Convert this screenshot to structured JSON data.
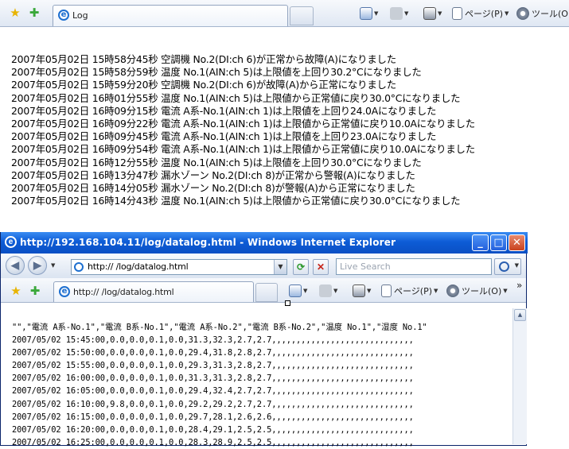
{
  "back_window": {
    "tab_title": "Log",
    "commands": [
      {
        "label": "ページ(P)",
        "icon": "page-icon"
      },
      {
        "label": "ツール(O)",
        "icon": "gear-icon"
      }
    ],
    "log_lines": [
      "2007年05月02日 15時58分45秒 空調機 No.2(DI:ch 6)が正常から故障(A)になりました",
      "2007年05月02日 15時58分59秒 温度 No.1(AIN:ch 5)は上限値を上回り30.2°Cになりました",
      "2007年05月02日 15時59分20秒 空調機 No.2(DI:ch 6)が故障(A)から正常になりました",
      "2007年05月02日 16時01分55秒 温度 No.1(AIN:ch 5)は上限値から正常値に戻り30.0°Cになりました",
      "2007年05月02日 16時09分15秒 電流 A系-No.1(AIN:ch 1)は上限値を上回り24.0Aになりました",
      "2007年05月02日 16時09分22秒 電流 A系-No.1(AIN:ch 1)は上限値から正常値に戻り10.0Aになりました",
      "2007年05月02日 16時09分45秒 電流 A系-No.1(AIN:ch 1)は上限値を上回り23.0Aになりました",
      "2007年05月02日 16時09分54秒 電流 A系-No.1(AIN:ch 1)は上限値から正常値に戻り10.0Aになりました",
      "2007年05月02日 16時12分55秒 温度 No.1(AIN:ch 5)は上限値を上回り30.0°Cになりました",
      "2007年05月02日 16時13分47秒 漏水ゾーン No.2(DI:ch 8)が正常から警報(A)になりました",
      "2007年05月02日 16時14分05秒 漏水ゾーン No.2(DI:ch 8)が警報(A)から正常になりました",
      "2007年05月02日 16時14分43秒 温度 No.1(AIN:ch 5)は上限値から正常値に戻り30.0°Cになりました"
    ]
  },
  "front_window": {
    "title": "http://192.168.104.11/log/datalog.html - Windows Internet Explorer",
    "address": "http://                   /log/datalog.html",
    "search_placeholder": "Live Search",
    "tab_title": "http://               /log/datalog.html",
    "commands": [
      {
        "label": "ページ(P)",
        "icon": "page-icon"
      },
      {
        "label": "ツール(O)",
        "icon": "gear-icon"
      }
    ],
    "overflow": "»",
    "csv_lines": [
      "\"\",\"電流 A系-No.1\",\"電流 B系-No.1\",\"電流 A系-No.2\",\"電流 B系-No.2\",\"温度 No.1\",\"湿度 No.1\"",
      "2007/05/02 15:45:00,0.0,0.0,0.1,0.0,31.3,32.3,2.7,2.7,,,,,,,,,,,,,,,,,,,,,,,,,,,,,",
      "2007/05/02 15:50:00,0.0,0.0,0.1,0.0,29.4,31.8,2.8,2.7,,,,,,,,,,,,,,,,,,,,,,,,,,,,,",
      "2007/05/02 15:55:00,0.0,0.0,0.1,0.0,29.3,31.3,2.8,2.7,,,,,,,,,,,,,,,,,,,,,,,,,,,,,",
      "2007/05/02 16:00:00,0.0,0.0,0.1,0.0,31.3,31.3,2.8,2.7,,,,,,,,,,,,,,,,,,,,,,,,,,,,,",
      "2007/05/02 16:05:00,0.0,0.0,0.1,0.0,29.4,32.4,2.7,2.7,,,,,,,,,,,,,,,,,,,,,,,,,,,,,",
      "2007/05/02 16:10:00,9.8,0.0,0.1,0.0,29.2,29.2,2.7,2.7,,,,,,,,,,,,,,,,,,,,,,,,,,,,,",
      "2007/05/02 16:15:00,0.0,0.0,0.1,0.0,29.7,28.1,2.6,2.6,,,,,,,,,,,,,,,,,,,,,,,,,,,,,",
      "2007/05/02 16:20:00,0.0,0.0,0.1,0.0,28.4,29.1,2.5,2.5,,,,,,,,,,,,,,,,,,,,,,,,,,,,,",
      "2007/05/02 16:25:00,0.0,0.0,0.1,0.0,28.3,28.9,2.5,2.5,,,,,,,,,,,,,,,,,,,,,,,,,,,,,"
    ]
  }
}
